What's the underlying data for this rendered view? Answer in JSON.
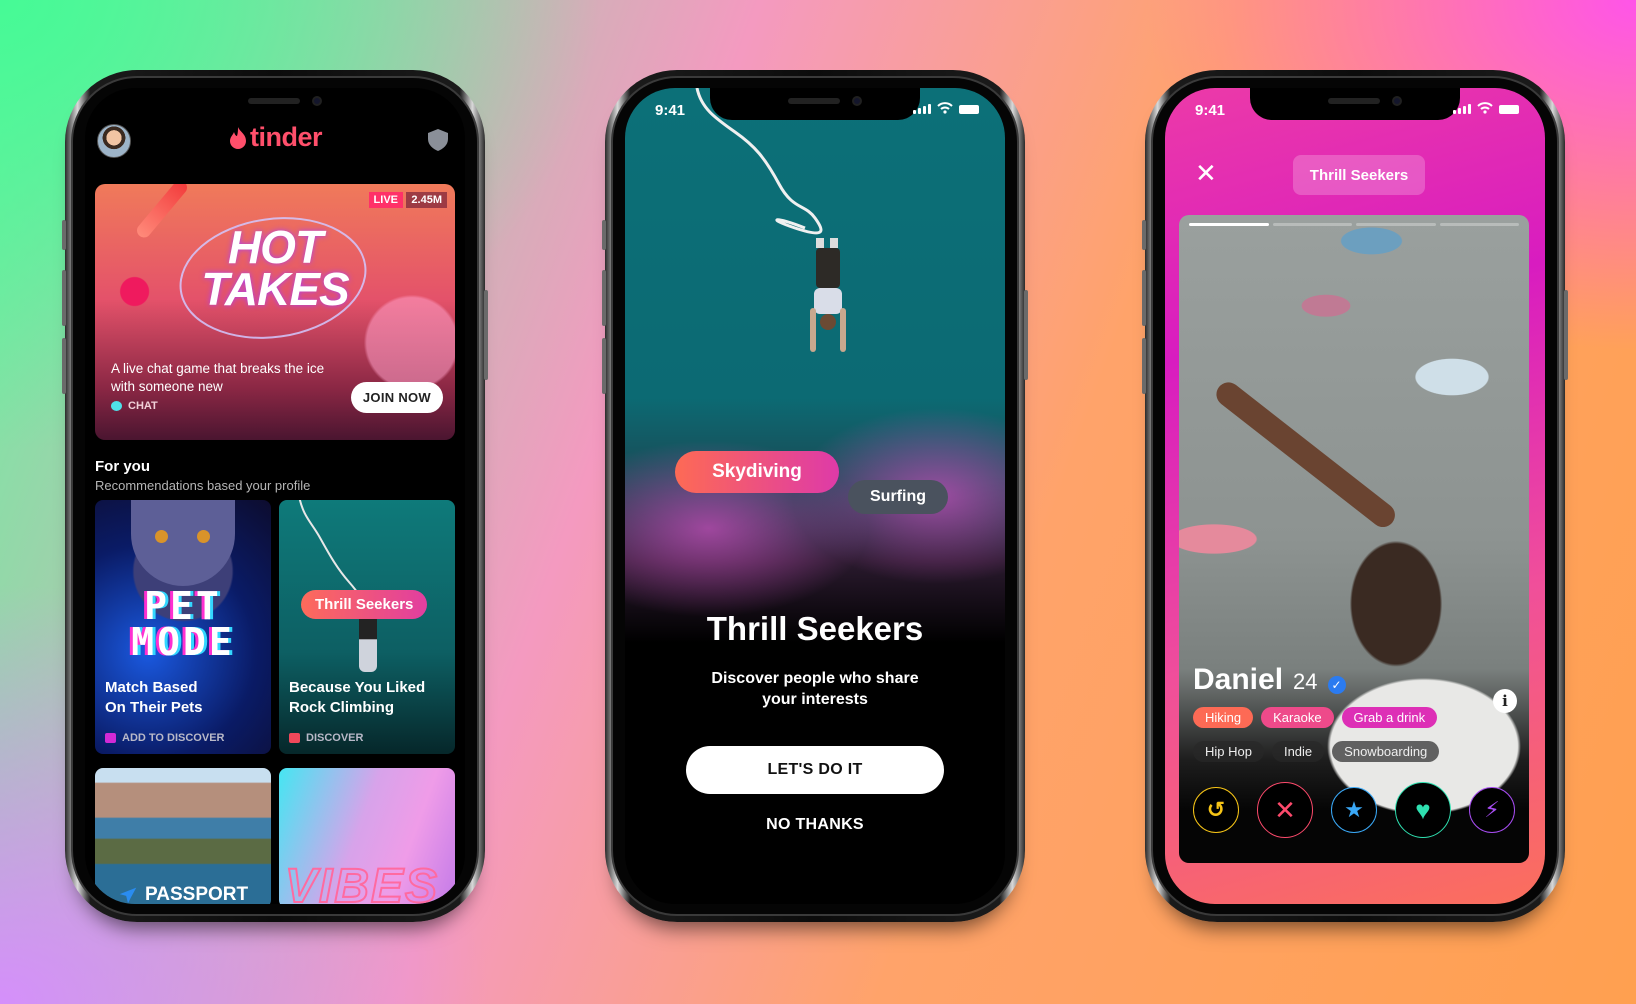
{
  "phones": {
    "discover": {
      "app_logo": "tinder",
      "header_icons": {
        "left": "profile-avatar",
        "right": "shield-icon"
      },
      "featured": {
        "title_line1": "HOT",
        "title_line2": "TAKES",
        "badge_live": "LIVE",
        "viewer_count": "2.45M",
        "description": "A live chat game that breaks the ice with someone new",
        "category": "CHAT",
        "cta": "JOIN NOW"
      },
      "section": {
        "title": "For you",
        "subtitle": "Recommendations based your profile"
      },
      "cards": [
        {
          "art_title": "PET MODE",
          "art_line1": "PET",
          "art_line2": "MODE",
          "title_line1": "Match Based",
          "title_line2": "On Their Pets",
          "footer": "ADD TO DISCOVER",
          "footer_color": "#d22ad6"
        },
        {
          "pill": "Thrill Seekers",
          "title_line1": "Because You Liked",
          "title_line2": "Rock Climbing",
          "footer": "DISCOVER",
          "footer_color": "#f0485a"
        },
        {
          "label": "PASSPORT",
          "icon": "plane-icon"
        },
        {
          "label": "VIBES"
        }
      ]
    },
    "onboarding": {
      "status_time": "9:41",
      "interest_primary": "Skydiving",
      "interest_secondary": "Surfing",
      "title": "Thrill Seekers",
      "subtitle": "Discover people who share your interests",
      "cta_primary": "LET'S DO IT",
      "cta_secondary": "NO THANKS"
    },
    "profile": {
      "status_time": "9:41",
      "close_icon": "close-icon",
      "mode_label": "Thrill Seekers",
      "photo_count": 4,
      "photo_index": 1,
      "name": "Daniel",
      "age": "24",
      "verified": true,
      "shared_interests": [
        {
          "label": "Hiking",
          "color": "#fd6a55"
        },
        {
          "label": "Karaoke",
          "color": "#ee4a8a"
        },
        {
          "label": "Grab a drink",
          "color": "#dd2fb6"
        }
      ],
      "other_interests": [
        "Hip Hop",
        "Indie",
        "Snowboarding"
      ],
      "actions": [
        {
          "name": "rewind",
          "glyph": "↺",
          "color": "#f6c416"
        },
        {
          "name": "nope",
          "glyph": "✕",
          "color": "#fd4a6c"
        },
        {
          "name": "super-like",
          "glyph": "★",
          "color": "#3aa8f6"
        },
        {
          "name": "like",
          "glyph": "♥",
          "color": "#2fe0b0"
        },
        {
          "name": "boost",
          "glyph": "⚡",
          "color": "#a64cf0"
        }
      ]
    }
  }
}
